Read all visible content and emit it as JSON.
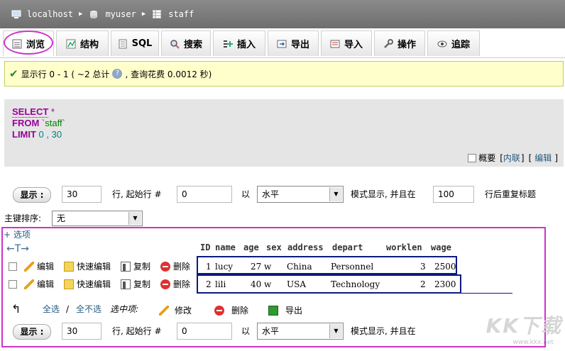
{
  "breadcrumb": {
    "server": "localhost",
    "database": "myuser",
    "table": "staff"
  },
  "tabs": [
    {
      "label": "浏览",
      "icon": "browse-icon"
    },
    {
      "label": "结构",
      "icon": "structure-icon"
    },
    {
      "label": "SQL",
      "icon": "sql-icon"
    },
    {
      "label": "搜索",
      "icon": "search-icon"
    },
    {
      "label": "插入",
      "icon": "insert-icon"
    },
    {
      "label": "导出",
      "icon": "export-icon"
    },
    {
      "label": "导入",
      "icon": "import-icon"
    },
    {
      "label": "操作",
      "icon": "wrench-icon"
    },
    {
      "label": "追踪",
      "icon": "eye-icon"
    }
  ],
  "notice": {
    "prefix": "显示行 0 - 1 ( ~2 总计",
    "suffix": ", 查询花费 0.0012 秒)"
  },
  "sql": {
    "select_kw": "SELECT",
    "select_rest": " *",
    "from_kw": "FROM",
    "from_rest": " `staff`",
    "limit_kw": "LIMIT",
    "limit_rest": " 0 , 30",
    "profile_label": "概要",
    "inline_label": "内联",
    "edit_label": "编辑"
  },
  "nav": {
    "show_button": "显示 :",
    "rows_value": "30",
    "start_label": "行, 起始行 #",
    "start_value": "0",
    "in_label": "以",
    "mode_value": "水平",
    "mode_label": "模式显示, 并且在",
    "repeat_value": "100",
    "repeat_label": "行后重复标题"
  },
  "sort": {
    "label": "主键排序:",
    "value": "无"
  },
  "options_label": "+ 选项",
  "table": {
    "columns": [
      "ID",
      "name",
      "age",
      "sex",
      "address",
      "depart",
      "worklen",
      "wage"
    ],
    "rows": [
      {
        "ID": "1",
        "name": "lucy",
        "age": "27",
        "sex": "w",
        "address": "China",
        "depart": "Personnel",
        "worklen": "3",
        "wage": "2500"
      },
      {
        "ID": "2",
        "name": "lili",
        "age": "40",
        "sex": "w",
        "address": "USA",
        "depart": "Technology",
        "worklen": "2",
        "wage": "2300"
      }
    ],
    "row_actions": {
      "edit": "编辑",
      "quick_edit": "快速编辑",
      "copy": "复制",
      "delete": "删除"
    }
  },
  "bulk": {
    "select_all": "全选",
    "separator": "/",
    "deselect_all": "全不选",
    "with_selected": "选中项:",
    "modify": "修改",
    "delete": "删除",
    "export": "导出"
  },
  "watermark": {
    "main": "KK下载",
    "sub": "www.kkx.net"
  },
  "colors": {
    "highlight_ring": "#cc33cc",
    "row_box": "#0c1a80",
    "keyword": "#990099",
    "notice_bg": "#ffffcc"
  }
}
